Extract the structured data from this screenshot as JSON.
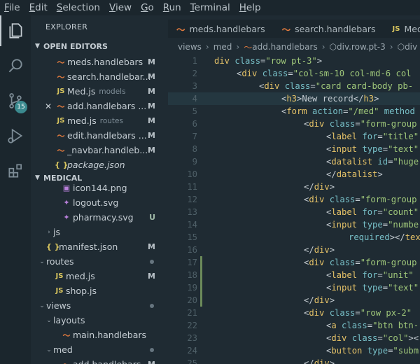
{
  "menu": [
    "File",
    "Edit",
    "Selection",
    "View",
    "Go",
    "Run",
    "Terminal",
    "Help"
  ],
  "activity": {
    "scm_badge": "15"
  },
  "sidebar": {
    "title": "EXPLORER",
    "open_editors": {
      "header": "OPEN EDITORS",
      "items": [
        {
          "icon": "handlebars-icon",
          "name": "meds.handlebars",
          "desc": "",
          "status": "M"
        },
        {
          "icon": "handlebars-icon",
          "name": "search.handlebar...",
          "desc": "",
          "status": "M"
        },
        {
          "icon": "js-icon",
          "name": "Med.js",
          "desc": "models",
          "status": "M"
        },
        {
          "icon": "handlebars-icon",
          "name": "add.handlebars ...",
          "desc": "",
          "status": "M",
          "close": true
        },
        {
          "icon": "js-icon",
          "name": "med.js",
          "desc": "routes",
          "status": "M"
        },
        {
          "icon": "handlebars-icon",
          "name": "edit.handlebars ...",
          "desc": "",
          "status": "M"
        },
        {
          "icon": "handlebars-icon",
          "name": "_navbar.handleb...",
          "desc": "",
          "status": "M"
        },
        {
          "icon": "json-icon",
          "name": "package.json",
          "desc": "",
          "status": "",
          "italic": true
        }
      ]
    },
    "project": {
      "header": "MEDICAL",
      "items": [
        {
          "icon": "image-icon",
          "name": "icon144.png",
          "status": "",
          "indent": 2
        },
        {
          "icon": "svg-icon",
          "name": "logout.svg",
          "status": "",
          "indent": 2
        },
        {
          "icon": "svg-icon",
          "name": "pharmacy.svg",
          "status": "U",
          "indent": 2
        },
        {
          "folder": true,
          "open": false,
          "name": "js",
          "indent": 1
        },
        {
          "icon": "json-icon",
          "name": "manifest.json",
          "status": "M",
          "indent": 0
        },
        {
          "folder": true,
          "open": true,
          "name": "routes",
          "dot": true,
          "indent": 0
        },
        {
          "icon": "js-icon",
          "name": "med.js",
          "status": "M",
          "indent": 1
        },
        {
          "icon": "js-icon",
          "name": "shop.js",
          "status": "",
          "indent": 1
        },
        {
          "folder": true,
          "open": true,
          "name": "views",
          "dot": true,
          "indent": 0
        },
        {
          "folder": true,
          "open": true,
          "name": "layouts",
          "indent": 1
        },
        {
          "icon": "handlebars-icon",
          "name": "main.handlebars",
          "status": "",
          "indent": 2
        },
        {
          "folder": true,
          "open": true,
          "name": "med",
          "dot": true,
          "indent": 1
        },
        {
          "icon": "handlebars-icon",
          "name": "add.handlebars",
          "status": "M",
          "indent": 2
        }
      ]
    }
  },
  "tabs": [
    {
      "icon": "handlebars-icon",
      "label": "meds.handlebars",
      "active": false
    },
    {
      "icon": "handlebars-icon",
      "label": "search.handlebars",
      "active": false
    },
    {
      "icon": "js-icon",
      "label": "Med.js",
      "active": false
    }
  ],
  "breadcrumb": [
    "views",
    "med",
    "add.handlebars",
    "div.row.pt-3",
    "div"
  ],
  "editor": {
    "lines": [
      {
        "n": 1,
        "indent": 0,
        "parts": [
          [
            "tg",
            "div "
          ],
          [
            "at",
            "class"
          ],
          [
            "tx",
            "="
          ],
          [
            "str",
            "\"row pt-3\""
          ],
          [
            "tx",
            ">"
          ]
        ]
      },
      {
        "n": 2,
        "indent": 1,
        "parts": [
          [
            "tx",
            "<"
          ],
          [
            "tg",
            "div "
          ],
          [
            "at",
            "class"
          ],
          [
            "tx",
            "="
          ],
          [
            "str",
            "\"col-sm-10 col-md-6 col"
          ]
        ]
      },
      {
        "n": 3,
        "indent": 2,
        "parts": [
          [
            "tx",
            "<"
          ],
          [
            "tg",
            "div "
          ],
          [
            "at",
            "class"
          ],
          [
            "tx",
            "="
          ],
          [
            "str",
            "\"card card-body pb-"
          ]
        ]
      },
      {
        "n": 4,
        "indent": 3,
        "cur": true,
        "parts": [
          [
            "tx",
            "<"
          ],
          [
            "tg",
            "h3"
          ],
          [
            "tx",
            ">New record</"
          ],
          [
            "tg",
            "h3"
          ],
          [
            "tx",
            ">"
          ]
        ]
      },
      {
        "n": 5,
        "indent": 3,
        "parts": [
          [
            "tx",
            "<"
          ],
          [
            "tg",
            "form "
          ],
          [
            "at",
            "action"
          ],
          [
            "tx",
            "="
          ],
          [
            "str",
            "\"/med\""
          ],
          [
            "at",
            " method"
          ]
        ]
      },
      {
        "n": 6,
        "indent": 4,
        "parts": [
          [
            "tx",
            "<"
          ],
          [
            "tg",
            "div "
          ],
          [
            "at",
            "class"
          ],
          [
            "tx",
            "="
          ],
          [
            "str",
            "\"form-group"
          ]
        ]
      },
      {
        "n": 7,
        "indent": 5,
        "parts": [
          [
            "tx",
            "<"
          ],
          [
            "tg",
            "label "
          ],
          [
            "at",
            "for"
          ],
          [
            "tx",
            "="
          ],
          [
            "str",
            "\"title\""
          ]
        ]
      },
      {
        "n": 8,
        "indent": 5,
        "parts": [
          [
            "tx",
            "<"
          ],
          [
            "tg",
            "input "
          ],
          [
            "at",
            "type"
          ],
          [
            "tx",
            "="
          ],
          [
            "str",
            "\"text\""
          ]
        ]
      },
      {
        "n": 9,
        "indent": 5,
        "parts": [
          [
            "tx",
            "<"
          ],
          [
            "tg",
            "datalist "
          ],
          [
            "at",
            "id"
          ],
          [
            "tx",
            "="
          ],
          [
            "str",
            "\"huge"
          ]
        ]
      },
      {
        "n": 10,
        "indent": 5,
        "parts": [
          [
            "tx",
            "</"
          ],
          [
            "tg",
            "datalist"
          ],
          [
            "tx",
            ">"
          ]
        ]
      },
      {
        "n": 11,
        "indent": 4,
        "parts": [
          [
            "tx",
            "</"
          ],
          [
            "tg",
            "div"
          ],
          [
            "tx",
            ">"
          ]
        ]
      },
      {
        "n": 12,
        "indent": 4,
        "parts": [
          [
            "tx",
            "<"
          ],
          [
            "tg",
            "div "
          ],
          [
            "at",
            "class"
          ],
          [
            "tx",
            "="
          ],
          [
            "str",
            "\"form-group"
          ]
        ]
      },
      {
        "n": 13,
        "indent": 5,
        "parts": [
          [
            "tx",
            "<"
          ],
          [
            "tg",
            "label "
          ],
          [
            "at",
            "for"
          ],
          [
            "tx",
            "="
          ],
          [
            "str",
            "\"count\""
          ]
        ]
      },
      {
        "n": 14,
        "indent": 5,
        "parts": [
          [
            "tx",
            "<"
          ],
          [
            "tg",
            "input "
          ],
          [
            "at",
            "type"
          ],
          [
            "tx",
            "="
          ],
          [
            "str",
            "\"numbe"
          ]
        ]
      },
      {
        "n": 15,
        "indent": 6,
        "parts": [
          [
            "at",
            "required"
          ],
          [
            "tx",
            "></"
          ],
          [
            "tg",
            "tex"
          ]
        ]
      },
      {
        "n": 16,
        "indent": 4,
        "parts": [
          [
            "tx",
            "</"
          ],
          [
            "tg",
            "div"
          ],
          [
            "tx",
            ">"
          ]
        ]
      },
      {
        "n": 17,
        "indent": 4,
        "gut": true,
        "parts": [
          [
            "tx",
            "<"
          ],
          [
            "tg",
            "div "
          ],
          [
            "at",
            "class"
          ],
          [
            "tx",
            "="
          ],
          [
            "str",
            "\"form-group"
          ]
        ]
      },
      {
        "n": 18,
        "indent": 5,
        "gut": true,
        "parts": [
          [
            "tx",
            "<"
          ],
          [
            "tg",
            "label "
          ],
          [
            "at",
            "for"
          ],
          [
            "tx",
            "="
          ],
          [
            "str",
            "\"unit\""
          ]
        ]
      },
      {
        "n": 19,
        "indent": 5,
        "gut": true,
        "parts": [
          [
            "tx",
            "<"
          ],
          [
            "tg",
            "input "
          ],
          [
            "at",
            "type"
          ],
          [
            "tx",
            "="
          ],
          [
            "str",
            "\"text\""
          ]
        ]
      },
      {
        "n": 20,
        "indent": 4,
        "gut": true,
        "parts": [
          [
            "tx",
            "</"
          ],
          [
            "tg",
            "div"
          ],
          [
            "tx",
            ">"
          ]
        ]
      },
      {
        "n": 21,
        "indent": 4,
        "parts": [
          [
            "tx",
            "<"
          ],
          [
            "tg",
            "div "
          ],
          [
            "at",
            "class"
          ],
          [
            "tx",
            "="
          ],
          [
            "str",
            "\"row px-2\""
          ]
        ]
      },
      {
        "n": 22,
        "indent": 5,
        "parts": [
          [
            "tx",
            "<"
          ],
          [
            "tg",
            "a "
          ],
          [
            "at",
            "class"
          ],
          [
            "tx",
            "="
          ],
          [
            "str",
            "\"btn btn-"
          ]
        ]
      },
      {
        "n": 23,
        "indent": 5,
        "parts": [
          [
            "tx",
            "<"
          ],
          [
            "tg",
            "div "
          ],
          [
            "at",
            "class"
          ],
          [
            "tx",
            "="
          ],
          [
            "str",
            "\"col\""
          ],
          [
            "tx",
            "><"
          ]
        ]
      },
      {
        "n": 24,
        "indent": 5,
        "parts": [
          [
            "tx",
            "<"
          ],
          [
            "tg",
            "button "
          ],
          [
            "at",
            "type"
          ],
          [
            "tx",
            "="
          ],
          [
            "str",
            "\"subm"
          ]
        ]
      },
      {
        "n": 25,
        "indent": 4,
        "parts": [
          [
            "tx",
            "</"
          ],
          [
            "tg",
            "div"
          ],
          [
            "tx",
            ">"
          ]
        ]
      }
    ]
  }
}
